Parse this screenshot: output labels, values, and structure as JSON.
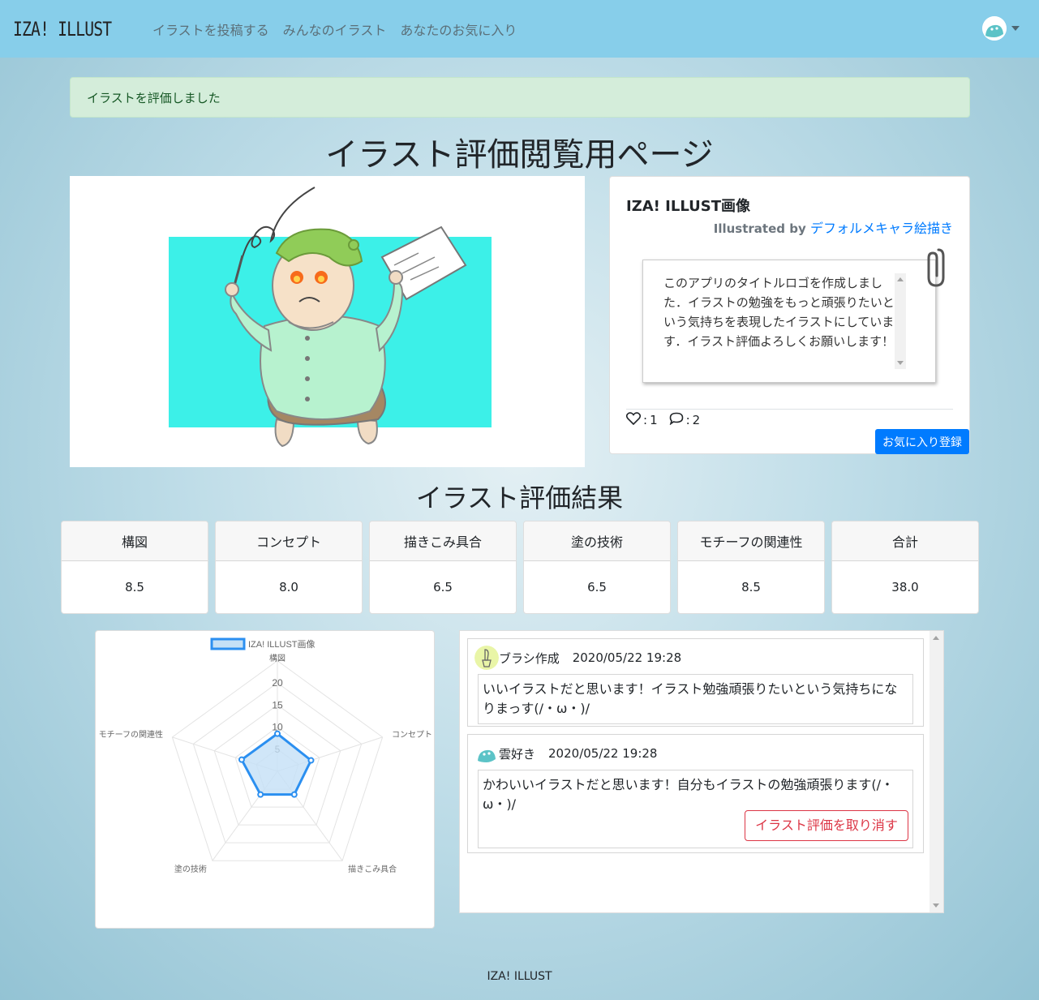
{
  "nav": {
    "brand": "IZA! ILLUST",
    "links": [
      "イラストを投稿する",
      "みんなのイラスト",
      "あなたのお気に入り"
    ]
  },
  "alert": {
    "message": "イラストを評価しました"
  },
  "page_title": "イラスト評価閲覧用ページ",
  "illust": {
    "title": "IZA! ILLUST画像",
    "by_prefix": "Illustrated by",
    "author": "デフォルメキャラ絵描き",
    "description": "このアプリのタイトルロゴを作成しました．イラストの勉強をもっと頑張りたいという気持ちを表現したイラストにしています．イラスト評価よろしくお願いします！",
    "likes": "1",
    "comments_count": "2",
    "favorite_button": "お気に入り登録"
  },
  "result_title": "イラスト評価結果",
  "scores": [
    {
      "label": "構図",
      "value": "8.5"
    },
    {
      "label": "コンセプト",
      "value": "8.0"
    },
    {
      "label": "描きこみ具合",
      "value": "6.5"
    },
    {
      "label": "塗の技術",
      "value": "6.5"
    },
    {
      "label": "モチーフの関連性",
      "value": "8.5"
    },
    {
      "label": "合計",
      "value": "38.0"
    }
  ],
  "chart_data": {
    "type": "radar",
    "categories": [
      "構図",
      "コンセプト",
      "描きこみ具合",
      "塗の技術",
      "モチーフの関連性"
    ],
    "series": [
      {
        "name": "IZA! ILLUST画像",
        "values": [
          8.5,
          8.0,
          6.5,
          6.5,
          8.5
        ]
      }
    ],
    "rlim": [
      0,
      20
    ],
    "ticks": [
      "5",
      "10",
      "15",
      "20"
    ],
    "legend": "top",
    "colors": {
      "line": "#2b8ff0",
      "fill": "#c4e0f6"
    }
  },
  "comments": [
    {
      "user": "ブラシ作成",
      "date": "2020/05/22 19:28",
      "text": "いいイラストだと思います！イラスト勉強頑張りたいという気持ちになりまっす(/・ω・)/"
    },
    {
      "user": "雲好き",
      "date": "2020/05/22 19:28",
      "text": "かわいいイラストだと思います！自分もイラストの勉強頑張ります(/・ω・)/",
      "delete_label": "イラスト評価を取り消す"
    }
  ],
  "footer": "IZA! ILLUST"
}
